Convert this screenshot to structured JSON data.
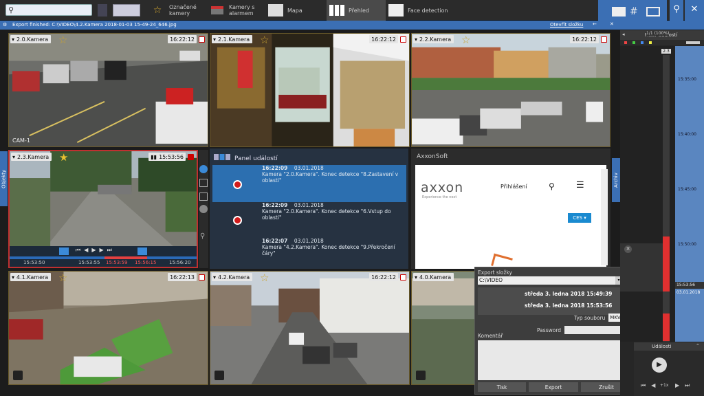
{
  "toolbar": {
    "search_placeholder": "",
    "favorites_label": "Označené kamery",
    "alarm_cams_label": "Kamery s alarmem",
    "map_label": "Mapa",
    "overview_label": "Přehled",
    "face_label": "Face detection"
  },
  "export_bar": {
    "message": "Export finished: C:\\VIDEO\\4.2.Kamera 2018-01-03 15-49-24_646.jpg",
    "open_folder": "Otevřít složku"
  },
  "side_tabs": {
    "left": "Objekty",
    "right": "Archiv"
  },
  "cameras": [
    {
      "name": "2.0.Kamera",
      "time": "16:22:12"
    },
    {
      "name": "2.1.Kamera",
      "time": "16:22:12"
    },
    {
      "name": "2.2.Kamera",
      "time": "16:22:12"
    },
    {
      "name": "2.3.Kamera",
      "time": "15:53:56"
    },
    {
      "name": "4.1.Kamera",
      "time": "16:22:13"
    },
    {
      "name": "4.2.Kamera",
      "time": "16:22:12"
    },
    {
      "name": "4.0.Kamera",
      "time": ""
    }
  ],
  "cam_watermark": "CAM-1",
  "playback": {
    "t1": "15:53:50",
    "t2": "15:53:55",
    "t3": "15:53:59",
    "t4": "15:56:15",
    "t5": "15:56:20"
  },
  "events_panel": {
    "title": "Panel událostí",
    "items": [
      {
        "time": "16:22:09",
        "date": "03.01.2018",
        "text": "Kamera \"2.0.Kamera\". Konec detekce \"8.Zastavení v oblasti\""
      },
      {
        "time": "16:22:09",
        "date": "03.01.2018",
        "text": "Kamera \"2.0.Kamera\". Konec detekce \"6.Vstup do oblasti\""
      },
      {
        "time": "16:22:07",
        "date": "03.01.2018",
        "text": "Kamera \"4.2.Kamera\". Konec detekce \"9.Překročení čáry\""
      }
    ]
  },
  "axxon": {
    "title": "AxxonSoft",
    "logo": "axxon",
    "tagline": "Experience the next",
    "login": "Přihlášení",
    "ces": "CES ▾"
  },
  "right_panel": {
    "filter_title": "Filter událostí",
    "page": "1/1 (100%)",
    "marker": "2.3",
    "times": [
      "15:35:00",
      "15:40:00",
      "15:45:00",
      "15:50:00",
      "15:53:56"
    ],
    "date": "03.01.2018",
    "events_label": "Události",
    "speed": "+1x"
  },
  "export_dialog": {
    "folder_label": "Export složky",
    "folder_value": "C:\\VIDEO",
    "start": "středa 3. ledna 2018 15:49:39",
    "end": "středa 3. ledna 2018 15:53:56",
    "type_label": "Typ souboru",
    "type_value": "MKV",
    "password_label": "Password",
    "comment_label": "Komentář",
    "print": "Tisk",
    "export": "Export",
    "cancel": "Zrušit"
  },
  "colors": {
    "accent": "#3b6fb4",
    "alarm": "#d21b1b",
    "star": "#c8a233"
  }
}
